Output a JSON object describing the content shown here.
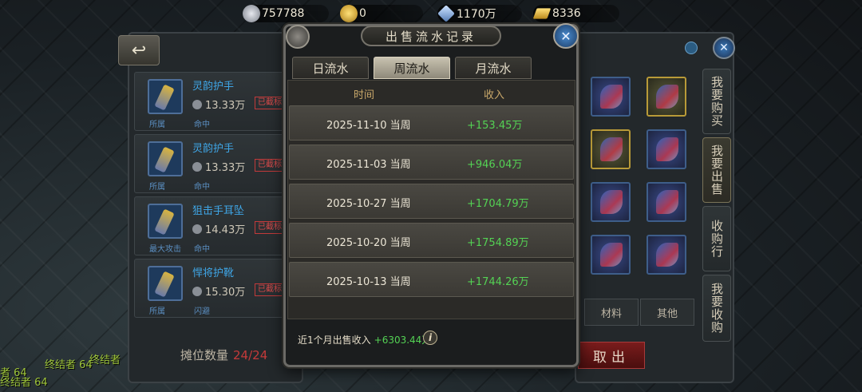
{
  "currency_bar": [
    {
      "icon": "silver-coin-icon",
      "value": "757788"
    },
    {
      "icon": "gold-coin-icon",
      "value": "0"
    },
    {
      "icon": "crystal-icon",
      "value": "1170万"
    },
    {
      "icon": "gold-bar-icon",
      "value": "8336"
    }
  ],
  "left_panel": {
    "back_label": "↩",
    "items": [
      {
        "name": "灵韵护手",
        "price": "13.33万",
        "tag": "已截标",
        "attr1": "所属",
        "attr2": "命中"
      },
      {
        "name": "灵韵护手",
        "price": "13.33万",
        "tag": "已截标",
        "attr1": "所属",
        "attr2": "命中"
      },
      {
        "name": "狙击手耳坠",
        "price": "14.43万",
        "tag": "已截标",
        "attr1": "最大攻击",
        "attr2": "命中"
      },
      {
        "name": "悍将护靴",
        "price": "15.30万",
        "tag": "已截标",
        "attr1": "所属",
        "attr2": "闪避"
      }
    ],
    "slot_label": "摊位数量",
    "slot_value": "24/24"
  },
  "modal": {
    "title": "出售流水记录",
    "tabs": [
      {
        "label": "日流水",
        "active": false
      },
      {
        "label": "周流水",
        "active": true
      },
      {
        "label": "月流水",
        "active": false
      }
    ],
    "columns": {
      "time": "时间",
      "income": "收入"
    },
    "rows": [
      {
        "date": "2025-11-10 当周",
        "income": "+153.45万"
      },
      {
        "date": "2025-11-03 当周",
        "income": "+946.04万"
      },
      {
        "date": "2025-10-27 当周",
        "income": "+1704.79万"
      },
      {
        "date": "2025-10-20 当周",
        "income": "+1754.89万"
      },
      {
        "date": "2025-10-13 当周",
        "income": "+1744.26万"
      }
    ],
    "footer_label": "近1个月出售收入",
    "footer_sum": "+6303.44万",
    "info_glyph": "i",
    "close_glyph": "✕"
  },
  "right_panel": {
    "side_tabs": [
      {
        "label": "我要购买",
        "active": false
      },
      {
        "label": "我要出售",
        "active": true
      },
      {
        "label": "收购行",
        "active": false
      },
      {
        "label": "我要收购",
        "active": false
      }
    ],
    "categories": [
      "材料",
      "其他"
    ],
    "takeout_label": "取出",
    "close_glyph": "✕"
  },
  "scene": {
    "player_names": [
      "终结者 64",
      "终结者",
      "终结者 64",
      "者 64"
    ]
  },
  "colors": {
    "income_green": "#54d254",
    "item_name_blue": "#3fa6e6",
    "alert_red": "#c43a3a"
  }
}
